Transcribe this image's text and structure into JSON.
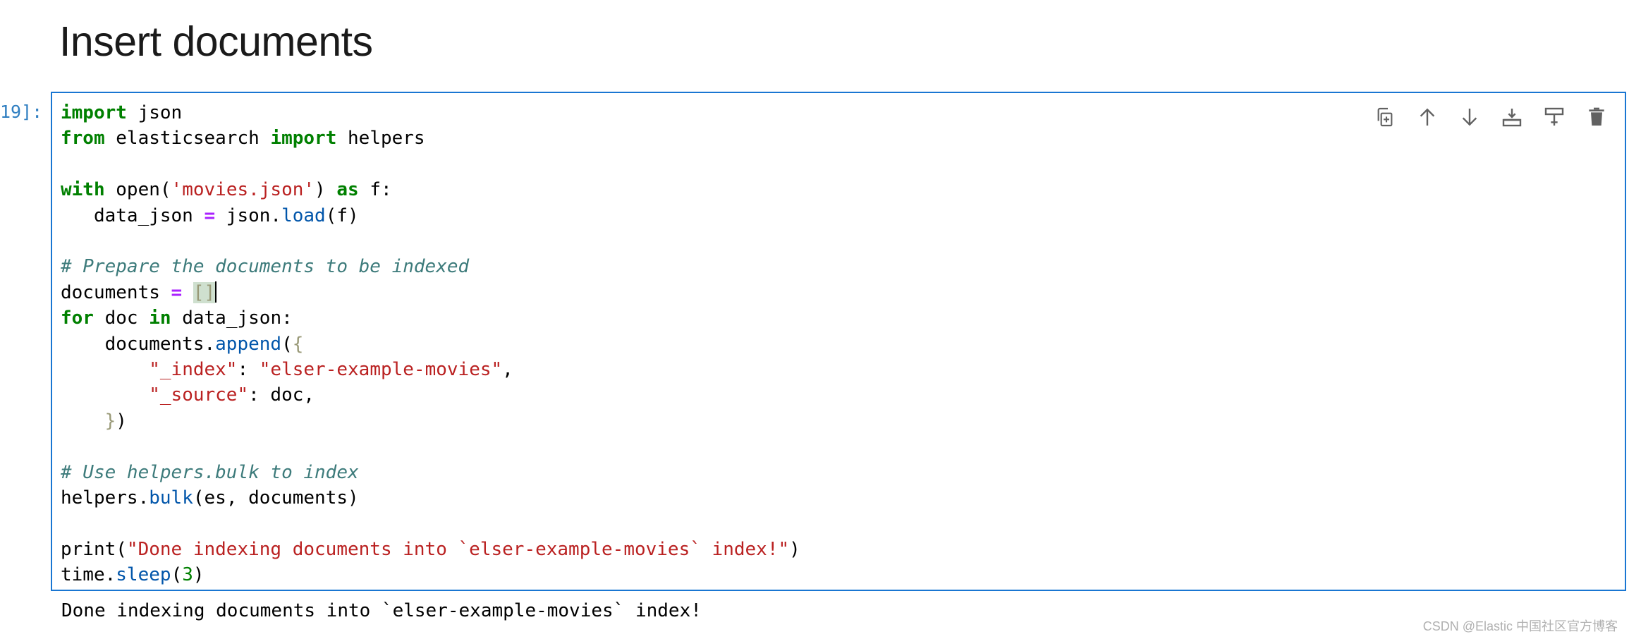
{
  "heading": "Insert documents",
  "cell": {
    "prompt": "19]:",
    "toolbar": [
      {
        "name": "duplicate-cell",
        "icon": "copy-icon"
      },
      {
        "name": "move-up",
        "icon": "arrow-up-icon"
      },
      {
        "name": "move-down",
        "icon": "arrow-down-icon"
      },
      {
        "name": "insert-below",
        "icon": "insert-below-icon"
      },
      {
        "name": "insert-above",
        "icon": "insert-above-icon"
      },
      {
        "name": "delete-cell",
        "icon": "trash-icon"
      }
    ],
    "code": {
      "l1_kw": "import",
      "l1_rest": " json",
      "l2_kw1": "from",
      "l2_mid": " elasticsearch ",
      "l2_kw2": "import",
      "l2_rest": " helpers",
      "l4_kw1": "with",
      "l4_a": " open(",
      "l4_str": "'movies.json'",
      "l4_b": ") ",
      "l4_kw2": "as",
      "l4_c": " f:",
      "l5_a": "   data_json ",
      "l5_op": "=",
      "l5_b": " json.",
      "l5_fn": "load",
      "l5_c": "(f)",
      "l7_cm": "# Prepare the documents to be indexed",
      "l8_a": "documents ",
      "l8_op": "=",
      "l8_sp": " ",
      "l8_sel": "[]",
      "l9_kw1": "for",
      "l9_a": " doc ",
      "l9_kw2": "in",
      "l9_b": " data_json:",
      "l10_a": "    documents.",
      "l10_fn": "append",
      "l10_b": "(",
      "l10_br": "{",
      "l11_ind": "        ",
      "l11_key": "\"_index\"",
      "l11_colon": ": ",
      "l11_val": "\"elser-example-movies\"",
      "l11_end": ",",
      "l12_ind": "        ",
      "l12_key": "\"_source\"",
      "l12_rest": ": doc,",
      "l13_ind": "    ",
      "l13_br": "}",
      "l13_rest": ")",
      "l15_cm": "# Use helpers.bulk to index",
      "l16_a": "helpers.",
      "l16_fn": "bulk",
      "l16_b": "(es, documents)",
      "l18_a": "print(",
      "l18_str": "\"Done indexing documents into `elser-example-movies` index!\"",
      "l18_b": ")",
      "l19_a": "time.",
      "l19_fn": "sleep",
      "l19_b": "(",
      "l19_num": "3",
      "l19_c": ")"
    },
    "output": "Done indexing documents into `elser-example-movies` index!"
  },
  "watermark": "CSDN @Elastic 中国社区官方博客"
}
